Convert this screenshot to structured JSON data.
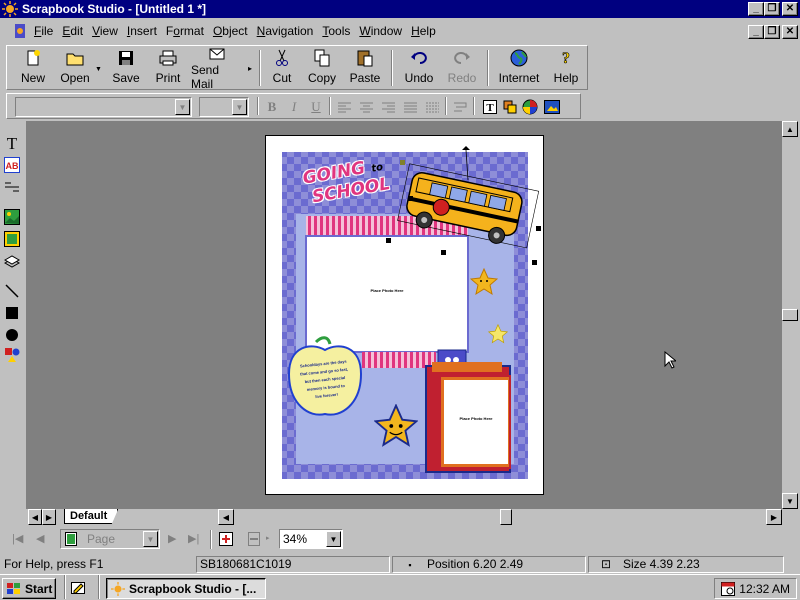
{
  "window": {
    "title": "Scrapbook Studio - [Untitled 1 *]"
  },
  "menu": {
    "items": [
      "File",
      "Edit",
      "View",
      "Insert",
      "Format",
      "Object",
      "Navigation",
      "Tools",
      "Window",
      "Help"
    ]
  },
  "toolbar": {
    "new": "New",
    "open": "Open",
    "save": "Save",
    "print": "Print",
    "send_mail": "Send Mail",
    "cut": "Cut",
    "copy": "Copy",
    "paste": "Paste",
    "undo": "Undo",
    "redo": "Redo",
    "internet": "Internet",
    "help": "Help"
  },
  "format": {
    "font_value": "",
    "size_value": "",
    "bold": "B",
    "italic": "I",
    "underline": "U"
  },
  "canvas": {
    "headline_1": "GOING",
    "headline_2": "to",
    "headline_3": "SCHOOL",
    "photo_1": "Place Photo Here",
    "photo_2": "Place Photo Here",
    "apple_text": [
      "Schooldays are the days",
      "that come and go so fast,",
      "but then each special",
      "memory is bound to",
      "live forever!"
    ]
  },
  "tabs": {
    "default": "Default"
  },
  "navbar": {
    "page_label": "Page",
    "zoom": "34%"
  },
  "status": {
    "help": "For Help, press F1",
    "doc_id": "SB180681C1019",
    "position": "Position 6.20 2.49",
    "size": "Size 4.39 2.23"
  },
  "taskbar": {
    "start": "Start",
    "task": "Scrapbook Studio - [...",
    "clock": "12:32 AM"
  },
  "colors": {
    "titlebar": "#000080",
    "face": "#c0c0c0",
    "workspace": "#808080",
    "page_bg": "#8e8ed8",
    "checker": "#6b6bd0",
    "bus": "#f5b21c",
    "star": "#f2b61e",
    "apple": "#f5f0a0",
    "pink": "#e0357f"
  }
}
